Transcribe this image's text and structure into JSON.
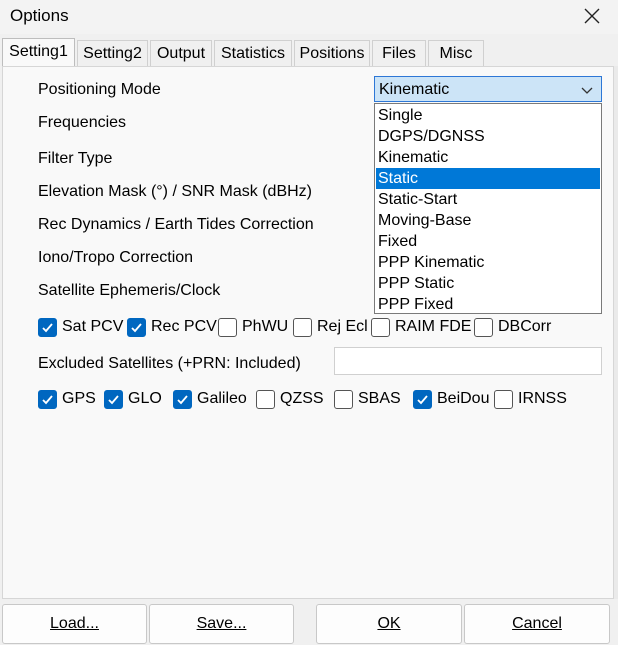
{
  "window": {
    "title": "Options"
  },
  "tabs": [
    "Setting1",
    "Setting2",
    "Output",
    "Statistics",
    "Positions",
    "Files",
    "Misc"
  ],
  "labels": {
    "positioning_mode": "Positioning Mode",
    "frequencies": "Frequencies",
    "filter_type": "Filter Type",
    "elevation_mask": "Elevation Mask (°) / SNR Mask (dBHz)",
    "rec_dynamics": "Rec Dynamics / Earth Tides Correction",
    "iono_tropo": "Iono/Tropo Correction",
    "ephemeris": "Satellite Ephemeris/Clock",
    "excluded": "Excluded Satellites (+PRN: Included)"
  },
  "positioning_mode": {
    "value": "Kinematic",
    "options": [
      "Single",
      "DGPS/DGNSS",
      "Kinematic",
      "Static",
      "Static-Start",
      "Moving-Base",
      "Fixed",
      "PPP Kinematic",
      "PPP Static",
      "PPP Fixed"
    ],
    "highlighted": "Static"
  },
  "options_checks": [
    {
      "label": "Sat PCV",
      "checked": true
    },
    {
      "label": "Rec PCV",
      "checked": true
    },
    {
      "label": "PhWU",
      "checked": false
    },
    {
      "label": "Rej Ecl",
      "checked": false
    },
    {
      "label": "RAIM FDE",
      "checked": false
    },
    {
      "label": "DBCorr",
      "checked": false
    }
  ],
  "excluded_satellites": {
    "value": ""
  },
  "constellations": [
    {
      "label": "GPS",
      "checked": true
    },
    {
      "label": "GLO",
      "checked": true
    },
    {
      "label": "Galileo",
      "checked": true
    },
    {
      "label": "QZSS",
      "checked": false
    },
    {
      "label": "SBAS",
      "checked": false
    },
    {
      "label": "BeiDou",
      "checked": true
    },
    {
      "label": "IRNSS",
      "checked": false
    }
  ],
  "buttons": {
    "load": "Load...",
    "save": "Save...",
    "ok": "OK",
    "cancel": "Cancel"
  }
}
